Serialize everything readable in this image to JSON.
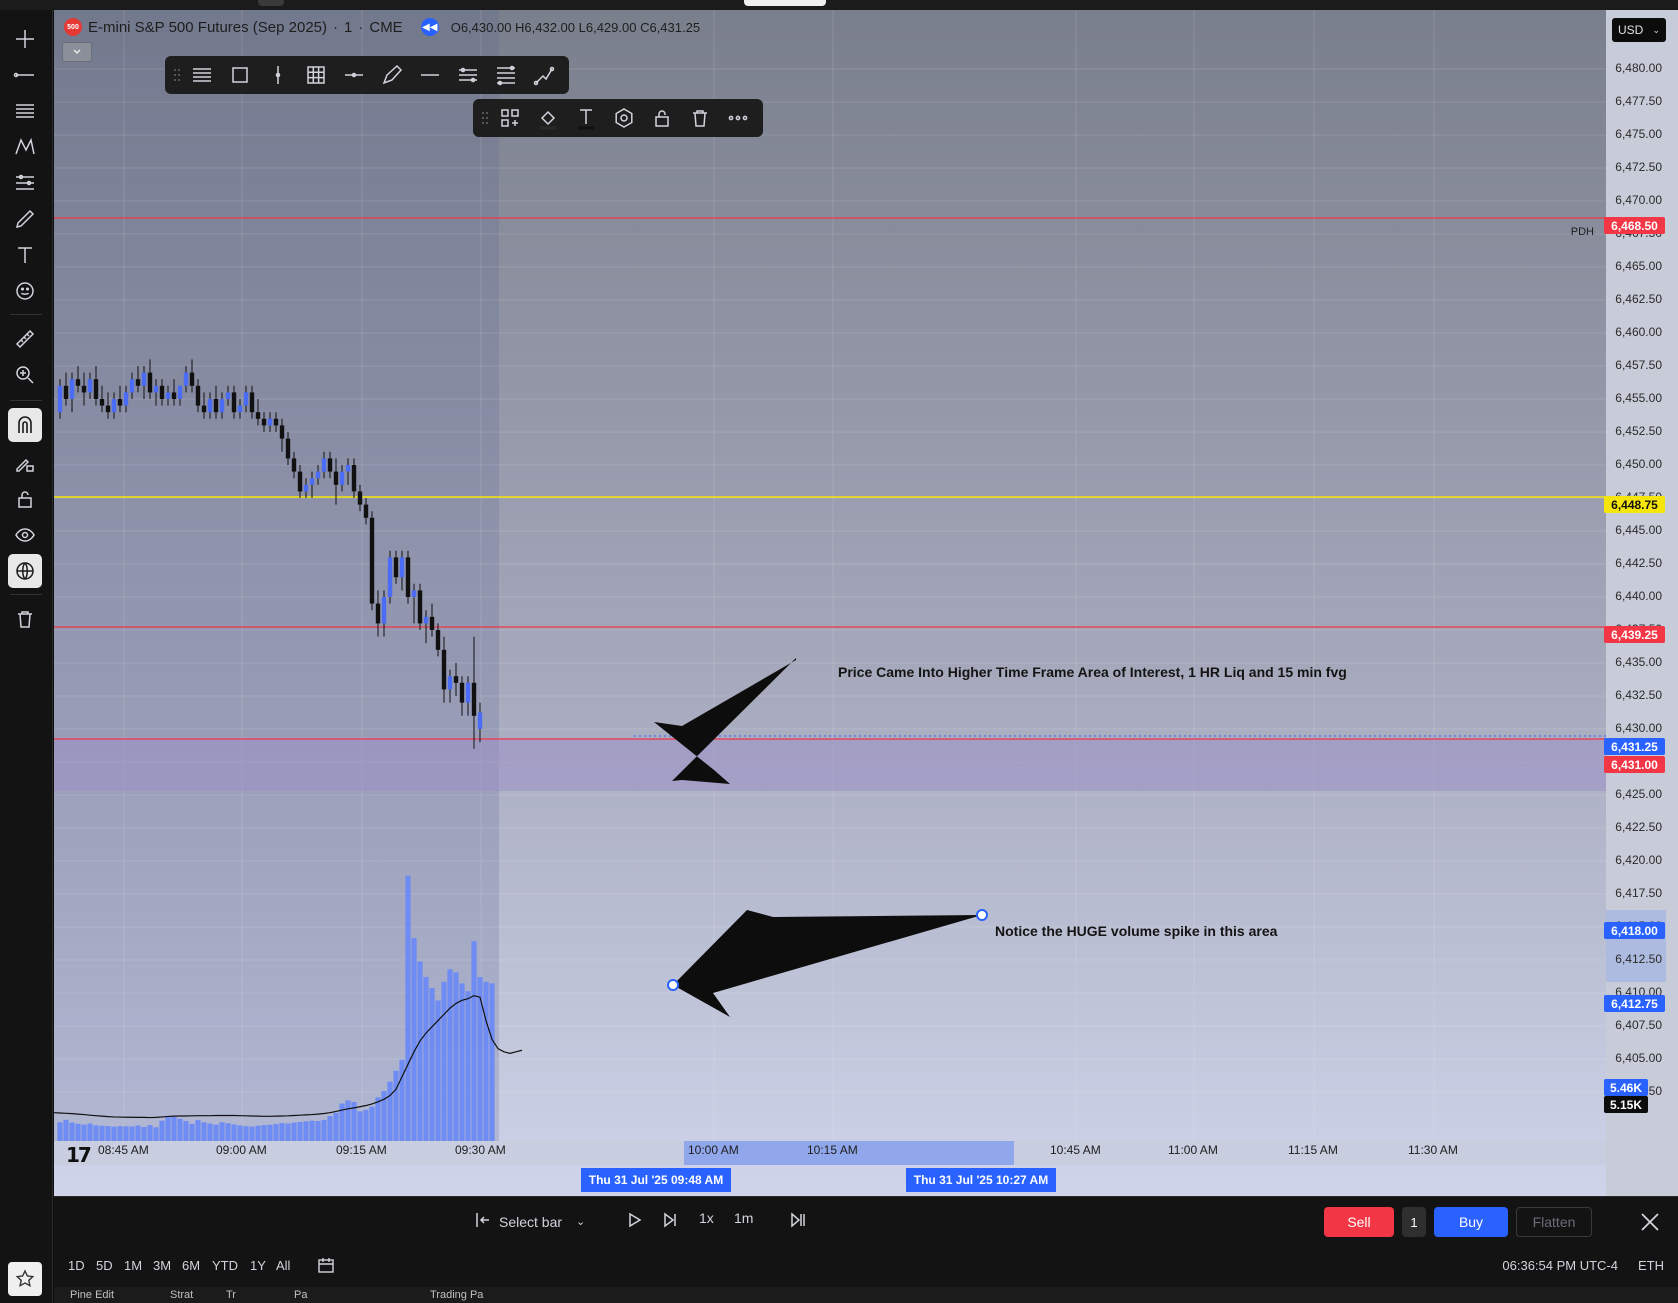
{
  "symbol": {
    "badge": "500",
    "name": "E-mini S&P 500 Futures (Sep 2025)",
    "interval": "1",
    "exchange": "CME",
    "ohlc": "O6,430.00 H6,432.00 L6,429.00 C6,431.25"
  },
  "currency": "USD",
  "price_ticks": [
    "6,480.00",
    "6,477.50",
    "6,475.00",
    "6,472.50",
    "6,470.00",
    "6,467.50",
    "6,465.00",
    "6,462.50",
    "6,460.00",
    "6,457.50",
    "6,455.00",
    "6,452.50",
    "6,450.00",
    "6,447.50",
    "6,445.00",
    "6,442.50",
    "6,440.00",
    "6,437.50",
    "6,435.00",
    "6,432.50",
    "6,430.00",
    "6,427.50",
    "6,425.00",
    "6,422.50",
    "6,420.00",
    "6,417.50",
    "6,415.00",
    "6,412.50",
    "6,410.00",
    "6,407.50",
    "6,405.00",
    "6,402.50"
  ],
  "price_labels": {
    "pdh": "6,468.50",
    "yellow": "6,448.75",
    "red2": "6,439.25",
    "current": "6,431.25",
    "red3": "6,431.00",
    "blue1": "6,418.00",
    "blue2": "6,412.75",
    "vol1": "5.46K",
    "vol2": "5.15K"
  },
  "pdh_text": "PDH",
  "annotations": {
    "a1": "Price Came Into Higher Time Frame Area  of Interest, 1 HR Liq and 15 min fvg",
    "a2": "Notice the HUGE volume spike in this area"
  },
  "time_ticks": [
    "08:45 AM",
    "09:00 AM",
    "09:15 AM",
    "09:30 AM",
    "10:00 AM",
    "10:15 AM",
    "10:45 AM",
    "11:00 AM",
    "11:15 AM",
    "11:30 AM"
  ],
  "time_chips": {
    "c1": "Thu 31 Jul '25   09:48 AM",
    "c2": "Thu 31 Jul '25   10:27 AM"
  },
  "tv_logo": "17",
  "replay": {
    "select_bar": "Select bar",
    "speed": "1x",
    "interval": "1m",
    "sell": "Sell",
    "qty": "1",
    "buy": "Buy",
    "flatten": "Flatten"
  },
  "ranges": [
    "1D",
    "5D",
    "1M",
    "3M",
    "6M",
    "YTD",
    "1Y",
    "All"
  ],
  "clock": "06:36:54 PM UTC-4",
  "session": "ETH",
  "bottom_tabs": [
    "Pine Edit",
    "Strat",
    "Tr",
    "Pa",
    "Trading Pa"
  ],
  "colors": {
    "up": "#4a6cf7",
    "down": "#111111",
    "red_line": "#f23645",
    "yellow_line": "#f5e50a",
    "accent": "#2962ff"
  },
  "chart_data": {
    "type": "candlestick",
    "x_label_range": [
      "08:38 AM",
      "09:53 AM"
    ],
    "ylim": [
      6401.25,
      6481.25
    ],
    "candles_ohlc": [
      [
        6454.0,
        6456.5,
        6453.5,
        6456.0
      ],
      [
        6456.0,
        6457.0,
        6454.5,
        6455.0
      ],
      [
        6455.0,
        6457.0,
        6454.0,
        6456.5
      ],
      [
        6456.5,
        6457.5,
        6455.5,
        6456.0
      ],
      [
        6456.0,
        6457.0,
        6454.5,
        6455.5
      ],
      [
        6455.5,
        6457.0,
        6455.0,
        6456.5
      ],
      [
        6456.5,
        6457.5,
        6454.5,
        6455.0
      ],
      [
        6455.0,
        6456.0,
        6454.0,
        6454.5
      ],
      [
        6454.5,
        6455.5,
        6453.5,
        6454.0
      ],
      [
        6454.0,
        6455.5,
        6453.5,
        6455.0
      ],
      [
        6455.0,
        6456.0,
        6454.0,
        6454.5
      ],
      [
        6454.5,
        6456.0,
        6454.0,
        6455.5
      ],
      [
        6455.5,
        6457.0,
        6455.0,
        6456.5
      ],
      [
        6456.5,
        6457.5,
        6455.5,
        6456.0
      ],
      [
        6456.0,
        6457.5,
        6455.0,
        6457.0
      ],
      [
        6457.0,
        6458.0,
        6455.0,
        6455.5
      ],
      [
        6455.5,
        6456.5,
        6454.5,
        6456.0
      ],
      [
        6456.0,
        6456.5,
        6454.5,
        6455.0
      ],
      [
        6455.0,
        6456.0,
        6454.5,
        6455.5
      ],
      [
        6455.5,
        6456.5,
        6454.5,
        6455.0
      ],
      [
        6455.0,
        6456.0,
        6454.5,
        6456.0
      ],
      [
        6456.0,
        6457.5,
        6455.5,
        6457.0
      ],
      [
        6457.0,
        6458.0,
        6455.5,
        6456.0
      ],
      [
        6456.0,
        6456.5,
        6454.0,
        6454.5
      ],
      [
        6454.5,
        6455.5,
        6453.5,
        6454.0
      ],
      [
        6454.0,
        6455.5,
        6453.5,
        6455.0
      ],
      [
        6455.0,
        6456.0,
        6453.5,
        6454.0
      ],
      [
        6454.0,
        6455.5,
        6453.5,
        6455.0
      ],
      [
        6455.0,
        6456.0,
        6454.5,
        6455.5
      ],
      [
        6455.5,
        6456.0,
        6453.5,
        6454.0
      ],
      [
        6454.0,
        6455.0,
        6453.5,
        6454.5
      ],
      [
        6454.5,
        6456.0,
        6454.0,
        6455.5
      ],
      [
        6455.5,
        6456.0,
        6453.5,
        6454.0
      ],
      [
        6454.0,
        6455.0,
        6453.0,
        6453.5
      ],
      [
        6453.5,
        6454.0,
        6452.5,
        6453.0
      ],
      [
        6453.0,
        6454.0,
        6452.5,
        6453.5
      ],
      [
        6453.5,
        6454.0,
        6452.5,
        6453.0
      ],
      [
        6453.0,
        6453.5,
        6451.0,
        6452.0
      ],
      [
        6452.0,
        6452.5,
        6450.0,
        6450.5
      ],
      [
        6450.5,
        6451.0,
        6449.0,
        6449.5
      ],
      [
        6449.5,
        6450.0,
        6447.5,
        6448.0
      ],
      [
        6448.0,
        6449.0,
        6447.5,
        6448.5
      ],
      [
        6448.5,
        6449.5,
        6447.5,
        6449.0
      ],
      [
        6449.0,
        6450.0,
        6448.5,
        6449.5
      ],
      [
        6449.5,
        6451.0,
        6449.0,
        6450.5
      ],
      [
        6450.5,
        6451.0,
        6449.0,
        6449.5
      ],
      [
        6449.5,
        6450.5,
        6447.0,
        6448.5
      ],
      [
        6448.5,
        6450.0,
        6448.0,
        6449.5
      ],
      [
        6449.5,
        6450.5,
        6448.5,
        6450.0
      ],
      [
        6450.0,
        6450.5,
        6447.5,
        6448.0
      ],
      [
        6448.0,
        6448.5,
        6446.5,
        6447.0
      ],
      [
        6447.0,
        6447.5,
        6445.5,
        6446.0
      ],
      [
        6446.0,
        6446.5,
        6439.0,
        6439.5
      ],
      [
        6439.5,
        6440.5,
        6437.0,
        6438.0
      ],
      [
        6438.0,
        6440.5,
        6437.0,
        6440.0
      ],
      [
        6440.0,
        6443.5,
        6439.5,
        6443.0
      ],
      [
        6443.0,
        6443.5,
        6441.0,
        6441.5
      ],
      [
        6441.5,
        6443.5,
        6440.5,
        6443.0
      ],
      [
        6443.0,
        6443.5,
        6439.5,
        6440.0
      ],
      [
        6440.0,
        6441.0,
        6438.0,
        6440.5
      ],
      [
        6440.5,
        6441.0,
        6437.5,
        6438.0
      ],
      [
        6438.0,
        6439.0,
        6436.5,
        6438.5
      ],
      [
        6438.5,
        6439.5,
        6437.0,
        6437.5
      ],
      [
        6437.5,
        6438.0,
        6435.5,
        6436.0
      ],
      [
        6436.0,
        6437.0,
        6432.0,
        6433.0
      ],
      [
        6433.0,
        6434.5,
        6432.0,
        6434.0
      ],
      [
        6434.0,
        6435.0,
        6432.5,
        6433.5
      ],
      [
        6433.5,
        6434.0,
        6431.0,
        6432.0
      ],
      [
        6432.0,
        6434.0,
        6431.0,
        6433.5
      ],
      [
        6433.5,
        6437.0,
        6428.5,
        6431.0
      ],
      [
        6430.0,
        6432.0,
        6429.0,
        6431.25
      ]
    ],
    "volume": [
      120,
      135,
      118,
      110,
      105,
      112,
      100,
      98,
      96,
      92,
      95,
      94,
      93,
      100,
      90,
      102,
      88,
      130,
      160,
      155,
      142,
      128,
      110,
      134,
      120,
      112,
      105,
      120,
      114,
      106,
      100,
      95,
      92,
      98,
      102,
      104,
      108,
      115,
      112,
      118,
      122,
      126,
      130,
      128,
      135,
      160,
      180,
      240,
      260,
      250,
      190,
      200,
      220,
      280,
      320,
      380,
      450,
      520,
      1700,
      1300,
      1150,
      1050,
      980,
      900,
      1020,
      1100,
      1080,
      1010,
      960,
      1280,
      1050,
      1020,
      1010
    ],
    "volume_ylim": [
      0,
      1800
    ],
    "volume_ma": [
      130,
      128,
      126,
      124,
      121,
      118,
      114,
      111,
      108,
      105,
      103,
      102,
      101,
      101,
      100,
      100,
      99,
      100,
      103,
      106,
      108,
      109,
      109,
      110,
      111,
      111,
      111,
      112,
      112,
      112,
      112,
      111,
      110,
      109,
      108,
      107,
      107,
      108,
      109,
      110,
      112,
      114,
      116,
      118,
      121,
      125,
      130,
      138,
      147,
      155,
      161,
      168,
      176,
      186,
      200,
      216,
      240,
      280,
      360,
      440,
      520,
      590,
      640,
      680,
      720,
      760,
      800,
      830,
      850,
      860,
      880,
      870,
      720,
      600,
      540,
      520,
      510,
      520,
      530
    ]
  }
}
